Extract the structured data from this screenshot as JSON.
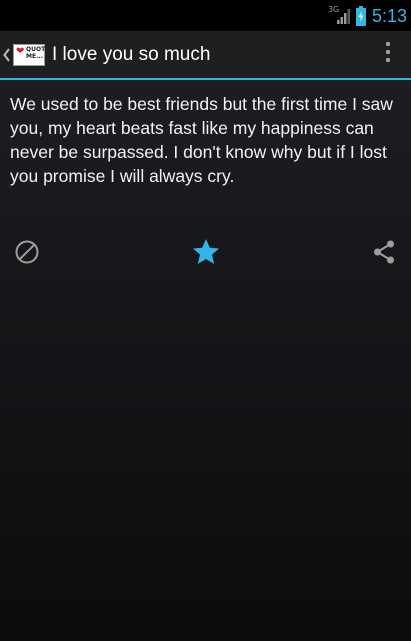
{
  "status_bar": {
    "network_type": "3G",
    "time": "5:13"
  },
  "action_bar": {
    "title": "I love you so much",
    "logo_text": "QUOTE\nME...",
    "up_icon": "chevron-left-icon",
    "overflow_icon": "overflow-menu-icon"
  },
  "quote": {
    "text": "We used to be best friends but the first time I saw you, my heart beats fast like my happiness can never be surpassed. I don't know why but if I lost you promise I will always cry."
  },
  "actions": {
    "block_icon": "block-icon",
    "favorite_icon": "star-icon",
    "share_icon": "share-icon"
  },
  "colors": {
    "accent": "#33b5e5",
    "background_top": "#1e2024",
    "background_bottom": "#0b0c0d",
    "icon_gray": "#9e9e9e"
  }
}
